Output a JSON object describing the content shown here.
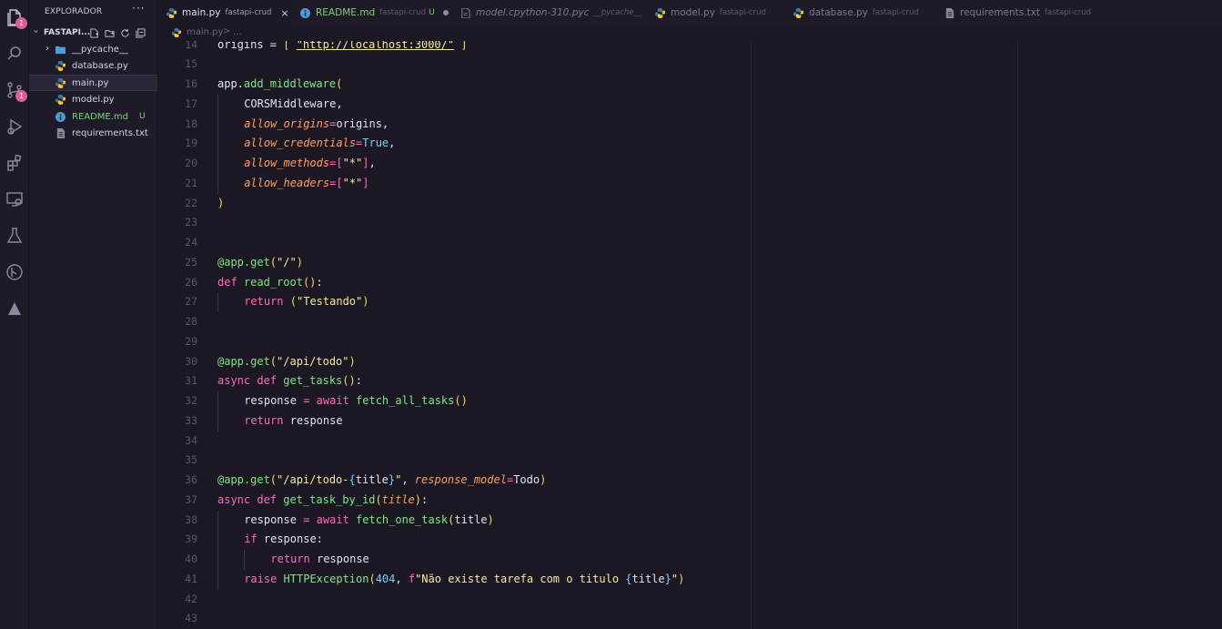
{
  "activity_bar": {
    "items": [
      {
        "name": "explorer-icon",
        "badge": "1"
      },
      {
        "name": "search-icon"
      },
      {
        "name": "source-control-icon",
        "badge": "1"
      },
      {
        "name": "run-debug-icon"
      },
      {
        "name": "extensions-icon"
      },
      {
        "name": "remote-explorer-icon"
      },
      {
        "name": "testing-icon"
      },
      {
        "name": "git-graph-icon"
      },
      {
        "name": "deploy-icon"
      }
    ]
  },
  "sidebar": {
    "title": "EXPLORADOR",
    "more": "···",
    "folder": "FASTAPI...",
    "items": [
      {
        "label": "__pycache__",
        "type": "folder"
      },
      {
        "label": "database.py",
        "type": "python"
      },
      {
        "label": "main.py",
        "type": "python",
        "active": true
      },
      {
        "label": "model.py",
        "type": "python"
      },
      {
        "label": "README.md",
        "type": "info",
        "status": "U"
      },
      {
        "label": "requirements.txt",
        "type": "text"
      }
    ]
  },
  "tabs": [
    {
      "label": "main.py",
      "desc": "fastapi-crud",
      "active": true,
      "close": "×"
    },
    {
      "label": "README.md",
      "desc": "fastapi-crud",
      "status": "U"
    },
    {
      "label": "model.cpython-310.pyc",
      "desc": "__pycache__"
    },
    {
      "label": "model.py",
      "desc": "fastapi-crud"
    },
    {
      "label": "database.py",
      "desc": "fastapi-crud"
    },
    {
      "label": "requirements.txt",
      "desc": "fastapi-crud"
    }
  ],
  "breadcrumb": {
    "file": "main.py",
    "sep": ">",
    "more": "..."
  },
  "colors": {
    "background": "#1b1723",
    "sidebar": "#1e1a27",
    "keyword": "#ff6ac1",
    "function": "#7ee787",
    "string": "#f8e8a6",
    "param": "#ff9e64"
  },
  "code_lines": [
    {
      "n": "14",
      "tokens": [
        [
          "k-white",
          "origins = "
        ],
        [
          "k-yellow",
          "[ "
        ],
        [
          "k-url",
          "\"http://localhost:3000/\""
        ],
        [
          "k-yellow",
          " ]"
        ]
      ]
    },
    {
      "n": "15",
      "tokens": []
    },
    {
      "n": "16",
      "tokens": [
        [
          "k-white",
          "app."
        ],
        [
          "k-green",
          "add_middleware"
        ],
        [
          "k-yellow",
          "("
        ]
      ]
    },
    {
      "n": "17",
      "indent": 1,
      "tokens": [
        [
          "k-white",
          "CORSMiddleware,"
        ]
      ]
    },
    {
      "n": "18",
      "indent": 1,
      "tokens": [
        [
          "k-orange",
          "allow_origins"
        ],
        [
          "k-pink",
          "="
        ],
        [
          "k-white",
          "origins,"
        ]
      ]
    },
    {
      "n": "19",
      "indent": 1,
      "tokens": [
        [
          "k-orange",
          "allow_credentials"
        ],
        [
          "k-pink",
          "="
        ],
        [
          "k-cyan",
          "True"
        ],
        [
          "k-white",
          ","
        ]
      ]
    },
    {
      "n": "20",
      "indent": 1,
      "tokens": [
        [
          "k-orange",
          "allow_methods"
        ],
        [
          "k-pink",
          "="
        ],
        [
          "k-pink",
          "["
        ],
        [
          "k-str",
          "\"*\""
        ],
        [
          "k-pink",
          "]"
        ],
        [
          "k-white",
          ","
        ]
      ]
    },
    {
      "n": "21",
      "indent": 1,
      "tokens": [
        [
          "k-orange",
          "allow_headers"
        ],
        [
          "k-pink",
          "="
        ],
        [
          "k-pink",
          "["
        ],
        [
          "k-str",
          "\"*\""
        ],
        [
          "k-pink",
          "]"
        ]
      ]
    },
    {
      "n": "22",
      "tokens": [
        [
          "k-yellow",
          ")"
        ]
      ]
    },
    {
      "n": "23",
      "tokens": []
    },
    {
      "n": "24",
      "tokens": []
    },
    {
      "n": "25",
      "tokens": [
        [
          "k-green",
          "@app.get"
        ],
        [
          "k-yellow",
          "("
        ],
        [
          "k-str",
          "\"/\""
        ],
        [
          "k-yellow",
          ")"
        ]
      ]
    },
    {
      "n": "26",
      "tokens": [
        [
          "k-pink",
          "def "
        ],
        [
          "k-green",
          "read_root"
        ],
        [
          "k-yellow",
          "()"
        ],
        [
          "k-white",
          ":"
        ]
      ]
    },
    {
      "n": "27",
      "indent": 1,
      "tokens": [
        [
          "k-pink",
          "return "
        ],
        [
          "k-yellow",
          "("
        ],
        [
          "k-str",
          "\"Testando\""
        ],
        [
          "k-yellow",
          ")"
        ]
      ]
    },
    {
      "n": "28",
      "tokens": []
    },
    {
      "n": "29",
      "tokens": []
    },
    {
      "n": "30",
      "tokens": [
        [
          "k-green",
          "@app.get"
        ],
        [
          "k-yellow",
          "("
        ],
        [
          "k-str",
          "\"/api/todo\""
        ],
        [
          "k-yellow",
          ")"
        ]
      ]
    },
    {
      "n": "31",
      "tokens": [
        [
          "k-pink",
          "async def "
        ],
        [
          "k-green",
          "get_tasks"
        ],
        [
          "k-yellow",
          "()"
        ],
        [
          "k-white",
          ":"
        ]
      ]
    },
    {
      "n": "32",
      "indent": 1,
      "tokens": [
        [
          "k-white",
          "response "
        ],
        [
          "k-pink",
          "= await "
        ],
        [
          "k-green",
          "fetch_all_tasks"
        ],
        [
          "k-yellow",
          "()"
        ]
      ]
    },
    {
      "n": "33",
      "indent": 1,
      "tokens": [
        [
          "k-pink",
          "return "
        ],
        [
          "k-white",
          "response"
        ]
      ]
    },
    {
      "n": "34",
      "tokens": []
    },
    {
      "n": "35",
      "tokens": []
    },
    {
      "n": "36",
      "tokens": [
        [
          "k-green",
          "@app.get"
        ],
        [
          "k-yellow",
          "("
        ],
        [
          "k-str",
          "\"/api/todo-"
        ],
        [
          "k-brace",
          "{"
        ],
        [
          "k-white",
          "title"
        ],
        [
          "k-brace",
          "}"
        ],
        [
          "k-str",
          "\""
        ],
        [
          "k-white",
          ", "
        ],
        [
          "k-orange",
          "response_model"
        ],
        [
          "k-pink",
          "="
        ],
        [
          "k-white",
          "Todo"
        ],
        [
          "k-yellow",
          ")"
        ]
      ]
    },
    {
      "n": "37",
      "tokens": [
        [
          "k-pink",
          "async def "
        ],
        [
          "k-green",
          "get_task_by_id"
        ],
        [
          "k-yellow",
          "("
        ],
        [
          "k-orange",
          "title"
        ],
        [
          "k-yellow",
          ")"
        ],
        [
          "k-white",
          ":"
        ]
      ]
    },
    {
      "n": "38",
      "indent": 1,
      "tokens": [
        [
          "k-white",
          "response "
        ],
        [
          "k-pink",
          "= await "
        ],
        [
          "k-green",
          "fetch_one_task"
        ],
        [
          "k-yellow",
          "("
        ],
        [
          "k-white",
          "title"
        ],
        [
          "k-yellow",
          ")"
        ]
      ]
    },
    {
      "n": "39",
      "indent": 1,
      "tokens": [
        [
          "k-pink",
          "if "
        ],
        [
          "k-white",
          "response:"
        ]
      ]
    },
    {
      "n": "40",
      "indent": 2,
      "tokens": [
        [
          "k-pink",
          "return "
        ],
        [
          "k-white",
          "response"
        ]
      ]
    },
    {
      "n": "41",
      "indent": 1,
      "tokens": [
        [
          "k-pink",
          "raise "
        ],
        [
          "k-green",
          "HTTPException"
        ],
        [
          "k-yellow",
          "("
        ],
        [
          "k-cyan",
          "404"
        ],
        [
          "k-white",
          ", "
        ],
        [
          "k-pink",
          "f"
        ],
        [
          "k-str",
          "\"Não existe tarefa com o titulo "
        ],
        [
          "k-brace",
          "{"
        ],
        [
          "k-white",
          "title"
        ],
        [
          "k-brace",
          "}"
        ],
        [
          "k-str",
          "\""
        ],
        [
          "k-yellow",
          ")"
        ]
      ]
    },
    {
      "n": "42",
      "tokens": []
    },
    {
      "n": "43",
      "tokens": []
    }
  ]
}
